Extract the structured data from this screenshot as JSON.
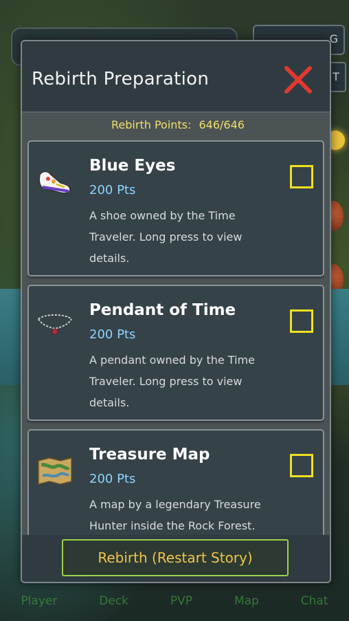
{
  "modal": {
    "title": "Rebirth Preparation",
    "points_label": "Rebirth Points:",
    "points_value": "646/646",
    "items": [
      {
        "name": "Blue Eyes",
        "points": "200 Pts",
        "description": "A shoe owned by the Time Traveler. Long press to view details.",
        "icon": "shoe-icon",
        "checked": false
      },
      {
        "name": "Pendant of Time",
        "points": "200 Pts",
        "description": "A pendant owned by the Time Traveler. Long press to view details.",
        "icon": "pendant-icon",
        "checked": false
      },
      {
        "name": "Treasure Map",
        "points": "200 Pts",
        "description": "A map by a legendary Treasure Hunter inside the Rock Forest.",
        "icon": "map-icon",
        "checked": false
      }
    ],
    "rebirth_button": "Rebirth (Restart Story)"
  },
  "background": {
    "gold_suffix": "G",
    "side_tab": "T",
    "nav": [
      "Player",
      "Deck",
      "PVP",
      "Map",
      "Chat"
    ]
  },
  "colors": {
    "title_text": "#f2f2f2",
    "close_x": "#e0392f",
    "points_text": "#f2df6b",
    "pts_text": "#8fd3ff",
    "checkbox": "#f0e020",
    "button_text": "#f2c44a",
    "button_border": "#9bd34a"
  }
}
